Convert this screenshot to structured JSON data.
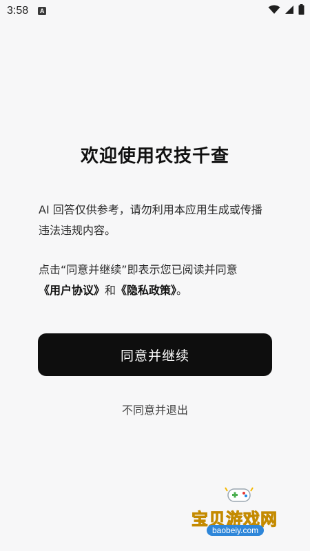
{
  "status_bar": {
    "time": "3:58",
    "a_icon": "A"
  },
  "dialog": {
    "title": "欢迎使用农技千查",
    "paragraph1": "AI 回答仅供参考，请勿利用本应用生成或传播违法违规内容。",
    "paragraph2_prefix": "点击“同意并继续”即表示您已阅读并同意",
    "user_agreement_link": "《用户协议》",
    "conjunction": "和",
    "privacy_policy_link": "《隐私政策》",
    "period": "。",
    "agree_button": "同意并继续",
    "disagree_link": "不同意并退出"
  },
  "watermark": {
    "text": "宝贝游戏网",
    "url": "baobeiy.com"
  },
  "colors": {
    "background": "#F7F7F8",
    "button_bg": "#0E0E0E",
    "watermark_yellow": "#F5B800",
    "watermark_blue": "#2E86D9"
  },
  "icons": [
    "a-notification-icon",
    "wifi-icon",
    "signal-icon",
    "battery-icon",
    "gamepad-icon"
  ]
}
